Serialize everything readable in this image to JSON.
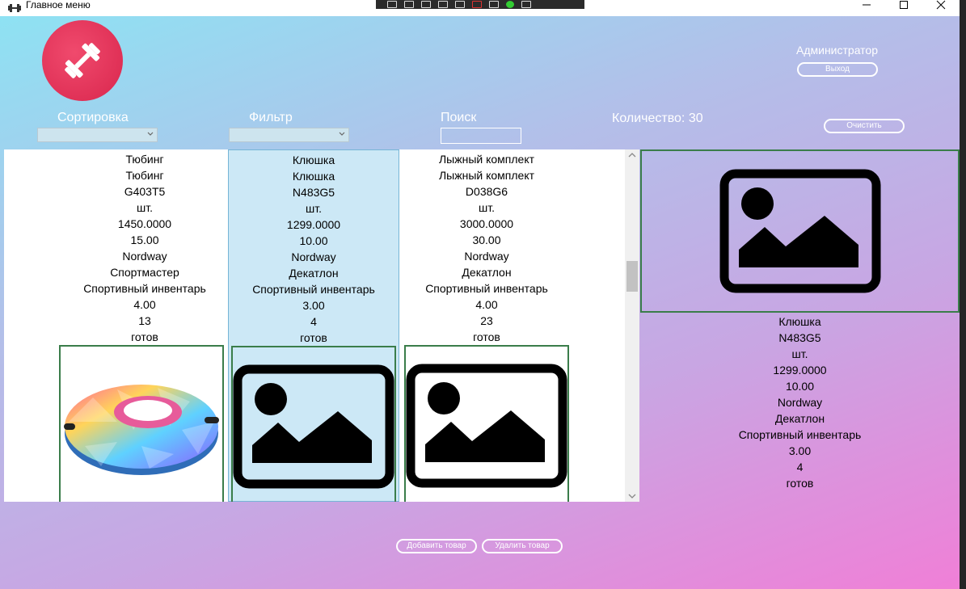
{
  "window": {
    "title": "Главное меню",
    "icons": [
      "dumbbell-icon",
      "minimize-icon",
      "maximize-icon",
      "close-icon"
    ]
  },
  "header": {
    "user_name": "Администратор",
    "logout_label": "Выход",
    "sort_label": "Сортировка",
    "sort_value": "",
    "filter_label": "Фильтр",
    "filter_value": "",
    "search_label": "Поиск",
    "search_value": "",
    "count_text": "Количество: 30",
    "clear_label": "Очистить"
  },
  "products": [
    {
      "name": "Тюбинг",
      "category_name": "Тюбинг",
      "article": "G403T5",
      "unit": "шт.",
      "price": "1450.0000",
      "discount_max": "15.00",
      "manufacturer": "Nordway",
      "supplier": "Спортмастер",
      "category": "Спортивный инвентарь",
      "discount": "4.00",
      "stock": "13",
      "status": "готов",
      "image": "tubing-photo",
      "selected": false
    },
    {
      "name": "Клюшка",
      "category_name": "Клюшка",
      "article": "N483G5",
      "unit": "шт.",
      "price": "1299.0000",
      "discount_max": "10.00",
      "manufacturer": "Nordway",
      "supplier": "Декатлон",
      "category": "Спортивный инвентарь",
      "discount": "3.00",
      "stock": "4",
      "status": "готов",
      "image": "image-placeholder-icon",
      "selected": true
    },
    {
      "name": "Лыжный комплект",
      "category_name": "Лыжный комплект",
      "article": "D038G6",
      "unit": "шт.",
      "price": "3000.0000",
      "discount_max": "30.00",
      "manufacturer": "Nordway",
      "supplier": "Декатлон",
      "category": "Спортивный инвентарь",
      "discount": "4.00",
      "stock": "23",
      "status": "готов",
      "image": "image-placeholder-icon",
      "selected": false
    }
  ],
  "detail": {
    "name": "Клюшка",
    "article": "N483G5",
    "unit": "шт.",
    "price": "1299.0000",
    "discount_max": "10.00",
    "manufacturer": "Nordway",
    "supplier": "Декатлон",
    "category": "Спортивный инвентарь",
    "discount": "3.00",
    "stock": "4",
    "status": "готов",
    "image": "image-placeholder-icon"
  },
  "footer": {
    "add_label": "Добавить товар",
    "delete_label": "Удалить товар"
  },
  "colors": {
    "gradient_start": "#8ee2f3",
    "gradient_end": "#f07fd7",
    "logo_red": "#e0304f",
    "selection": "#cce8f6",
    "frame_green": "#3a7d4a"
  }
}
